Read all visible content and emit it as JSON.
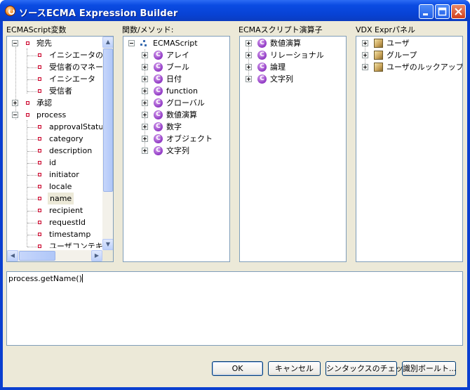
{
  "window": {
    "title": "ソースECMA Expression Builder"
  },
  "panels": {
    "ecma_vars": {
      "label": "ECMAScript変数",
      "items": [
        {
          "label": "宛先"
        },
        {
          "label": "イニシエータのマ"
        },
        {
          "label": "受信者のマネー"
        },
        {
          "label": "イニシエータ"
        },
        {
          "label": "受信者"
        },
        {
          "label": "承認"
        },
        {
          "label": "process"
        },
        {
          "label": "approvalStatu"
        },
        {
          "label": "category"
        },
        {
          "label": "description"
        },
        {
          "label": "id"
        },
        {
          "label": "initiator"
        },
        {
          "label": "locale"
        },
        {
          "label": "name"
        },
        {
          "label": "recipient"
        },
        {
          "label": "requestId"
        },
        {
          "label": "timestamp"
        },
        {
          "label": "ユーザコンテキ"
        }
      ]
    },
    "functions": {
      "label": "関数/メソッド:",
      "items": [
        {
          "label": "ECMAScript"
        },
        {
          "label": "アレイ"
        },
        {
          "label": "ブール"
        },
        {
          "label": "日付"
        },
        {
          "label": "function"
        },
        {
          "label": "グローバル"
        },
        {
          "label": "数値演算"
        },
        {
          "label": "数字"
        },
        {
          "label": "オブジェクト"
        },
        {
          "label": "文字列"
        }
      ]
    },
    "operators": {
      "label": "ECMAスクリプト演算子",
      "items": [
        {
          "label": "数値演算"
        },
        {
          "label": "リレーショナル"
        },
        {
          "label": "論理"
        },
        {
          "label": "文字列"
        }
      ]
    },
    "vdx": {
      "label": "VDX Exprパネル",
      "items": [
        {
          "label": "ユーザ"
        },
        {
          "label": "グループ"
        },
        {
          "label": "ユーザのルックアップ"
        }
      ]
    }
  },
  "editor": {
    "value": "process.getName()"
  },
  "buttons": {
    "ok": "OK",
    "cancel": "キャンセル",
    "syntax_check": "シンタックスのチェック",
    "id_vault": "識別ボールト..."
  },
  "colors": {
    "titlebar": "#0842d4",
    "client_bg": "#ece9d8",
    "panel_border": "#7f9db9"
  }
}
